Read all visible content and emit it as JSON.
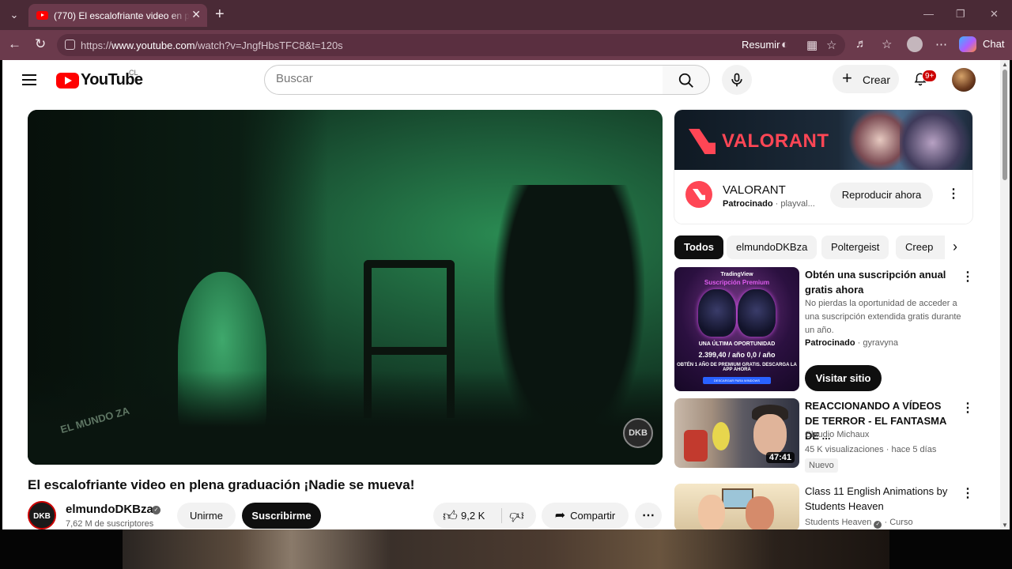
{
  "browser": {
    "tab_title": "(770) El escalofriante video en plena graduación ¡Nadie se mueva!",
    "url_prefix": "https://",
    "url_host": "www.youtube.com",
    "url_path": "/watch?v=JngfHbsTFC8&t=120s",
    "summarize_label": "Resumir",
    "chat_label": "Chat"
  },
  "header": {
    "logo_text": "YouTube",
    "country_code": "CL",
    "search_placeholder": "Buscar",
    "create_label": "Crear",
    "notification_count": "9+"
  },
  "video": {
    "title": "El escalofriante video en plena graduación ¡Nadie se mueva!",
    "channel_name": "elmundoDKBza",
    "channel_avatar_text": "DKB",
    "subscribers": "7,62 M de suscriptores",
    "join_label": "Unirme",
    "subscribe_label": "Suscribirme",
    "likes": "9,2 K",
    "share_label": "Compartir",
    "watermark_text": "DKB"
  },
  "ad": {
    "banner_text": "VALORANT",
    "name": "VALORANT",
    "sponsored_label": "Patrocinado",
    "advertiser": "playval...",
    "cta_label": "Reproducir ahora"
  },
  "chips": [
    "Todos",
    "elmundoDKBza",
    "Poltergeist",
    "Creep"
  ],
  "recommendations": [
    {
      "title": "Obtén una suscripción anual gratis ahora",
      "description": "No pierdas la oportunidad de acceder a una suscripción extendida gratis durante un año.",
      "sponsored_label": "Patrocinado",
      "advertiser": "gyravyna",
      "cta_label": "Visitar sitio",
      "thumb_brand": "TradingView",
      "thumb_line1": "Suscripción Premium",
      "thumb_line2": "UNA ÚLTIMA OPORTUNIDAD",
      "thumb_line3": "2.399,40 / año  0,0 / año",
      "thumb_line4": "OBTÉN 1 AÑO DE PREMIUM GRATIS. DESCARGA LA APP AHORA",
      "thumb_button": "DESCARGAR PARA WINDOWS"
    },
    {
      "title": "REACCIONANDO A VÍDEOS DE TERROR - EL FANTASMA DE ...",
      "channel": "Claudio Michaux",
      "views": "45 K visualizaciones",
      "age": "hace 5 días",
      "badge": "Nuevo",
      "duration": "47:41"
    },
    {
      "title": "Class 11 English Animations by Students Heaven",
      "channel": "Students Heaven",
      "type": "Curso"
    }
  ]
}
